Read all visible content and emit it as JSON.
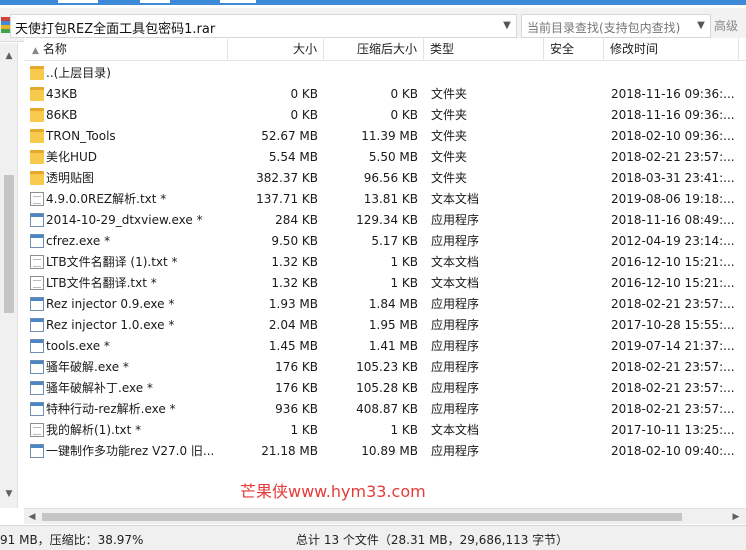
{
  "app": {
    "archive_path": "天使打包REZ全面工具包密码1.rar",
    "search_placeholder": "当前目录查找(支持包内查找)",
    "search_button": "高级"
  },
  "columns": {
    "name": "名称",
    "size": "大小",
    "packed": "压缩后大小",
    "type": "类型",
    "security": "安全",
    "modified": "修改时间"
  },
  "rows": [
    {
      "name": "..(上层目录)",
      "size": "",
      "packed": "",
      "type": "",
      "modified": "",
      "icon": "folder-icon"
    },
    {
      "name": "43KB",
      "size": "0 KB",
      "packed": "0 KB",
      "type": "文件夹",
      "modified": "2018-11-16 09:36:...",
      "icon": "folder-icon"
    },
    {
      "name": "86KB",
      "size": "0 KB",
      "packed": "0 KB",
      "type": "文件夹",
      "modified": "2018-11-16 09:36:...",
      "icon": "folder-icon"
    },
    {
      "name": "TRON_Tools",
      "size": "52.67 MB",
      "packed": "11.39 MB",
      "type": "文件夹",
      "modified": "2018-02-10 09:36:...",
      "icon": "folder-icon"
    },
    {
      "name": "美化HUD",
      "size": "5.54 MB",
      "packed": "5.50 MB",
      "type": "文件夹",
      "modified": "2018-02-21 23:57:...",
      "icon": "folder-icon"
    },
    {
      "name": "透明贴图",
      "size": "382.37 KB",
      "packed": "96.56 KB",
      "type": "文件夹",
      "modified": "2018-03-31 23:41:...",
      "icon": "folder-icon"
    },
    {
      "name": "4.9.0.0REZ解析.txt *",
      "size": "137.71 KB",
      "packed": "13.81 KB",
      "type": "文本文档",
      "modified": "2019-08-06 19:18:...",
      "icon": "text-file-icon"
    },
    {
      "name": "2014-10-29_dtxview.exe *",
      "size": "284 KB",
      "packed": "129.34 KB",
      "type": "应用程序",
      "modified": "2018-11-16 08:49:...",
      "icon": "application-icon"
    },
    {
      "name": "cfrez.exe *",
      "size": "9.50 KB",
      "packed": "5.17 KB",
      "type": "应用程序",
      "modified": "2012-04-19 23:14:...",
      "icon": "application-icon"
    },
    {
      "name": "LTB文件名翻译 (1).txt *",
      "size": "1.32 KB",
      "packed": "1 KB",
      "type": "文本文档",
      "modified": "2016-12-10 15:21:...",
      "icon": "text-file-icon"
    },
    {
      "name": "LTB文件名翻译.txt *",
      "size": "1.32 KB",
      "packed": "1 KB",
      "type": "文本文档",
      "modified": "2016-12-10 15:21:...",
      "icon": "text-file-icon"
    },
    {
      "name": "Rez injector 0.9.exe *",
      "size": "1.93 MB",
      "packed": "1.84 MB",
      "type": "应用程序",
      "modified": "2018-02-21 23:57:...",
      "icon": "application-icon"
    },
    {
      "name": "Rez injector 1.0.exe *",
      "size": "2.04 MB",
      "packed": "1.95 MB",
      "type": "应用程序",
      "modified": "2017-10-28 15:55:...",
      "icon": "application-icon"
    },
    {
      "name": "tools.exe *",
      "size": "1.45 MB",
      "packed": "1.41 MB",
      "type": "应用程序",
      "modified": "2019-07-14 21:37:...",
      "icon": "application-icon"
    },
    {
      "name": "骚年破解.exe *",
      "size": "176 KB",
      "packed": "105.23 KB",
      "type": "应用程序",
      "modified": "2018-02-21 23:57:...",
      "icon": "application-icon"
    },
    {
      "name": "骚年破解补丁.exe *",
      "size": "176 KB",
      "packed": "105.28 KB",
      "type": "应用程序",
      "modified": "2018-02-21 23:57:...",
      "icon": "application-icon"
    },
    {
      "name": "特种行动-rez解析.exe *",
      "size": "936 KB",
      "packed": "408.87 KB",
      "type": "应用程序",
      "modified": "2018-02-21 23:57:...",
      "icon": "application-icon"
    },
    {
      "name": "我的解析(1).txt *",
      "size": "1 KB",
      "packed": "1 KB",
      "type": "文本文档",
      "modified": "2017-10-11 13:25:...",
      "icon": "text-file-icon"
    },
    {
      "name": "一键制作多功能rez V27.0 旧...",
      "size": "21.18 MB",
      "packed": "10.89 MB",
      "type": "应用程序",
      "modified": "2018-02-10 09:40:...",
      "icon": "application-icon"
    }
  ],
  "watermark": "芒果侠www.hym33.com",
  "status": {
    "left": "91 MB，压缩比：38.97%",
    "right": "总计 13 个文件（28.31 MB，29,686,113 字节）"
  },
  "colors": {
    "accent": "#3c8ad8",
    "folder": "#f7c94d",
    "watermark": "#e53a3a"
  }
}
